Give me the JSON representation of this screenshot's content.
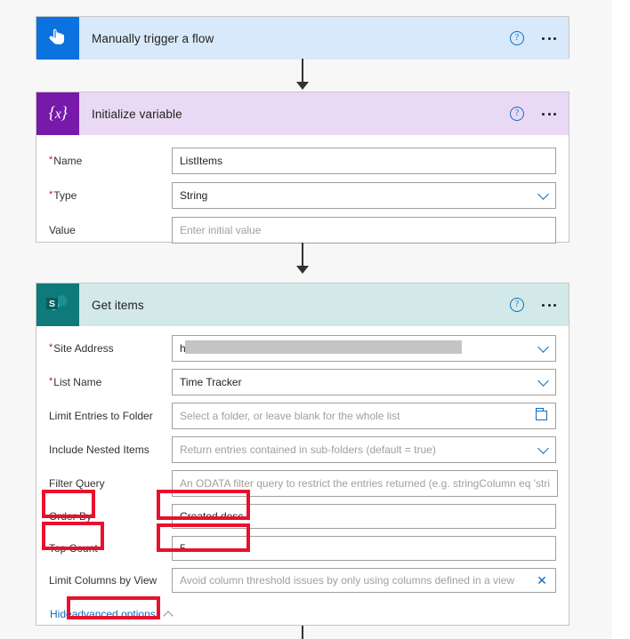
{
  "canvas": {
    "background": "#f7f7f7"
  },
  "cards": [
    {
      "id": "trigger",
      "title": "Manually trigger a flow",
      "icon": "touch-pointer-icon",
      "icon_color": "#0b72df",
      "header_bg": "#d8e9fb",
      "help_label": "?",
      "fields": []
    },
    {
      "id": "initialize-variable",
      "title": "Initialize variable",
      "icon": "variable-braces-icon",
      "icon_color": "#7719aa",
      "header_bg": "#ead9f5",
      "help_label": "?",
      "fields": [
        {
          "label": "Name",
          "required": true,
          "value": "ListItems",
          "placeholder": "",
          "control": "text"
        },
        {
          "label": "Type",
          "required": true,
          "value": "String",
          "placeholder": "",
          "control": "dropdown"
        },
        {
          "label": "Value",
          "required": false,
          "value": "",
          "placeholder": "Enter initial value",
          "control": "text"
        }
      ]
    },
    {
      "id": "get-items",
      "title": "Get items",
      "icon": "sharepoint-icon",
      "icon_color": "#0f7a7a",
      "header_bg": "#d3e9e9",
      "help_label": "?",
      "fields": [
        {
          "label": "Site Address",
          "required": true,
          "value": "h",
          "placeholder": "",
          "control": "dropdown",
          "redacted": true
        },
        {
          "label": "List Name",
          "required": true,
          "value": "Time Tracker",
          "placeholder": "",
          "control": "dropdown"
        },
        {
          "label": "Limit Entries to Folder",
          "required": false,
          "value": "",
          "placeholder": "Select a folder, or leave blank for the whole list",
          "control": "folder"
        },
        {
          "label": "Include Nested Items",
          "required": false,
          "value": "",
          "placeholder": "Return entries contained in sub-folders (default = true)",
          "control": "dropdown"
        },
        {
          "label": "Filter Query",
          "required": false,
          "value": "",
          "placeholder": "An ODATA filter query to restrict the entries returned (e.g. stringColumn eq 'stri",
          "control": "text"
        },
        {
          "label": "Order By",
          "required": false,
          "value": "Created desc",
          "placeholder": "",
          "control": "text"
        },
        {
          "label": "Top Count",
          "required": false,
          "value": "5",
          "placeholder": "",
          "control": "text"
        },
        {
          "label": "Limit Columns by View",
          "required": false,
          "value": "",
          "placeholder": "Avoid column threshold issues by only using columns defined in a view",
          "control": "clear"
        }
      ],
      "advanced": {
        "prefix": "Hide",
        "highlight": "advanced options",
        "caret": "chevron-up-icon"
      }
    }
  ],
  "annotations": {
    "color": "#e8112d",
    "boxes": [
      {
        "name": "order-by-label-highlight",
        "target": "Order By"
      },
      {
        "name": "order-by-value-highlight",
        "target": "Created desc"
      },
      {
        "name": "top-count-label-highlight",
        "target": "Top Count"
      },
      {
        "name": "top-count-value-highlight",
        "target": "5"
      },
      {
        "name": "advanced-options-highlight",
        "target": "advanced options"
      }
    ]
  }
}
